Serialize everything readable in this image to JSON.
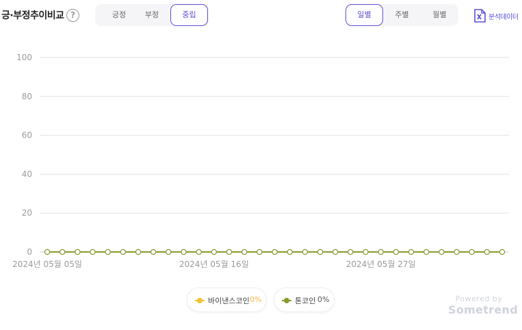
{
  "header": {
    "title": "긍·부정추이비교",
    "help_symbol": "?"
  },
  "sentiment_tabs": [
    {
      "label": "긍정",
      "active": false
    },
    {
      "label": "부정",
      "active": false
    },
    {
      "label": "중립",
      "active": true
    }
  ],
  "period_tabs": [
    {
      "label": "일별",
      "active": true
    },
    {
      "label": "주별",
      "active": false
    },
    {
      "label": "월별",
      "active": false
    }
  ],
  "export": {
    "label": "분석데이터",
    "icon": "excel-file-icon"
  },
  "colors": {
    "accent": "#5b4ed6",
    "series1": "#f2c230",
    "series2": "#8a9a2e",
    "grid": "#e2e2e2"
  },
  "chart_data": {
    "type": "line",
    "ylim": [
      0,
      100
    ],
    "yticks": [
      "0",
      "20",
      "40",
      "60",
      "80",
      "100"
    ],
    "x_labels": [
      {
        "index": 0,
        "label": "2024년 05월 05일"
      },
      {
        "index": 11,
        "label": "2024년 05월 16일"
      },
      {
        "index": 22,
        "label": "2024년 05월 27일"
      }
    ],
    "point_count": 31,
    "series": [
      {
        "name": "바이낸스코인",
        "percent": "0%",
        "values": [
          0,
          0,
          0,
          0,
          0,
          0,
          0,
          0,
          0,
          0,
          0,
          0,
          0,
          0,
          0,
          0,
          0,
          0,
          0,
          0,
          0,
          0,
          0,
          0,
          0,
          0,
          0,
          0,
          0,
          0,
          0
        ]
      },
      {
        "name": "톤코인",
        "percent": "0%",
        "values": [
          0,
          0,
          0,
          0,
          0,
          0,
          0,
          0,
          0,
          0,
          0,
          0,
          0,
          0,
          0,
          0,
          0,
          0,
          0,
          0,
          0,
          0,
          0,
          0,
          0,
          0,
          0,
          0,
          0,
          0,
          0
        ]
      }
    ]
  },
  "branding": {
    "powered_by": "Powered by",
    "brand": "Sometrend"
  }
}
